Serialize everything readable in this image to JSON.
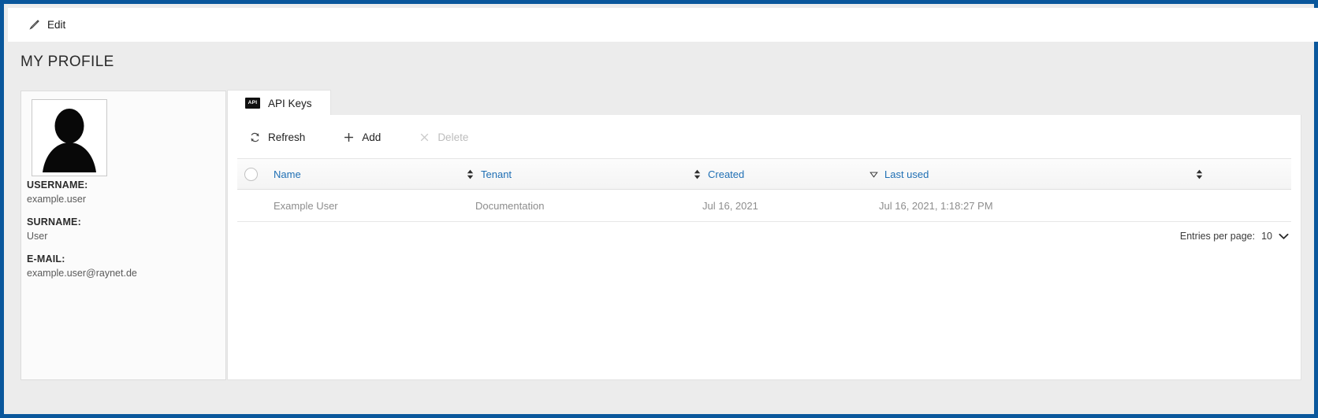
{
  "theme": {
    "frame_border": "#0a579c",
    "page_bg": "#ececec",
    "panel_bg": "#ffffff",
    "link_blue": "#1f6fb4",
    "muted_text": "#8d8d8d"
  },
  "command_bar": {
    "edit": {
      "label": "Edit",
      "icon": "pencil-icon"
    }
  },
  "page": {
    "title": "MY PROFILE"
  },
  "profile": {
    "avatar_icon": "user-silhouette-icon",
    "fields": [
      {
        "label": "USERNAME:",
        "value": "example.user"
      },
      {
        "label": "SURNAME:",
        "value": "User"
      },
      {
        "label": "E-MAIL:",
        "value": "example.user@raynet.de"
      }
    ]
  },
  "tabs": [
    {
      "label": "API Keys",
      "badge": "API",
      "icon": "api-badge-icon",
      "active": true
    }
  ],
  "toolbar": {
    "refresh": {
      "label": "Refresh",
      "icon": "refresh-icon",
      "disabled": false
    },
    "add": {
      "label": "Add",
      "icon": "plus-icon",
      "disabled": false
    },
    "delete": {
      "label": "Delete",
      "icon": "close-x-icon",
      "disabled": true
    }
  },
  "table": {
    "select_all_icon": "circle-checkbox-icon",
    "columns": [
      {
        "label": "Name",
        "sort": "none",
        "sort_icon": "sort-both-icon"
      },
      {
        "label": "Tenant",
        "sort": "none",
        "sort_icon": "sort-both-icon"
      },
      {
        "label": "Created",
        "sort": "none",
        "sort_icon": "sort-both-icon"
      },
      {
        "label": "Last used",
        "sort": "desc",
        "sort_icon": "sort-desc-icon"
      }
    ],
    "rows": [
      {
        "name": "Example User",
        "tenant": "Documentation",
        "created": "Jul 16, 2021",
        "last_used": "Jul 16, 2021, 1:18:27 PM"
      }
    ]
  },
  "pagination": {
    "entries_label": "Entries per page:",
    "entries_value": "10",
    "chevron_icon": "chevron-down-icon"
  }
}
